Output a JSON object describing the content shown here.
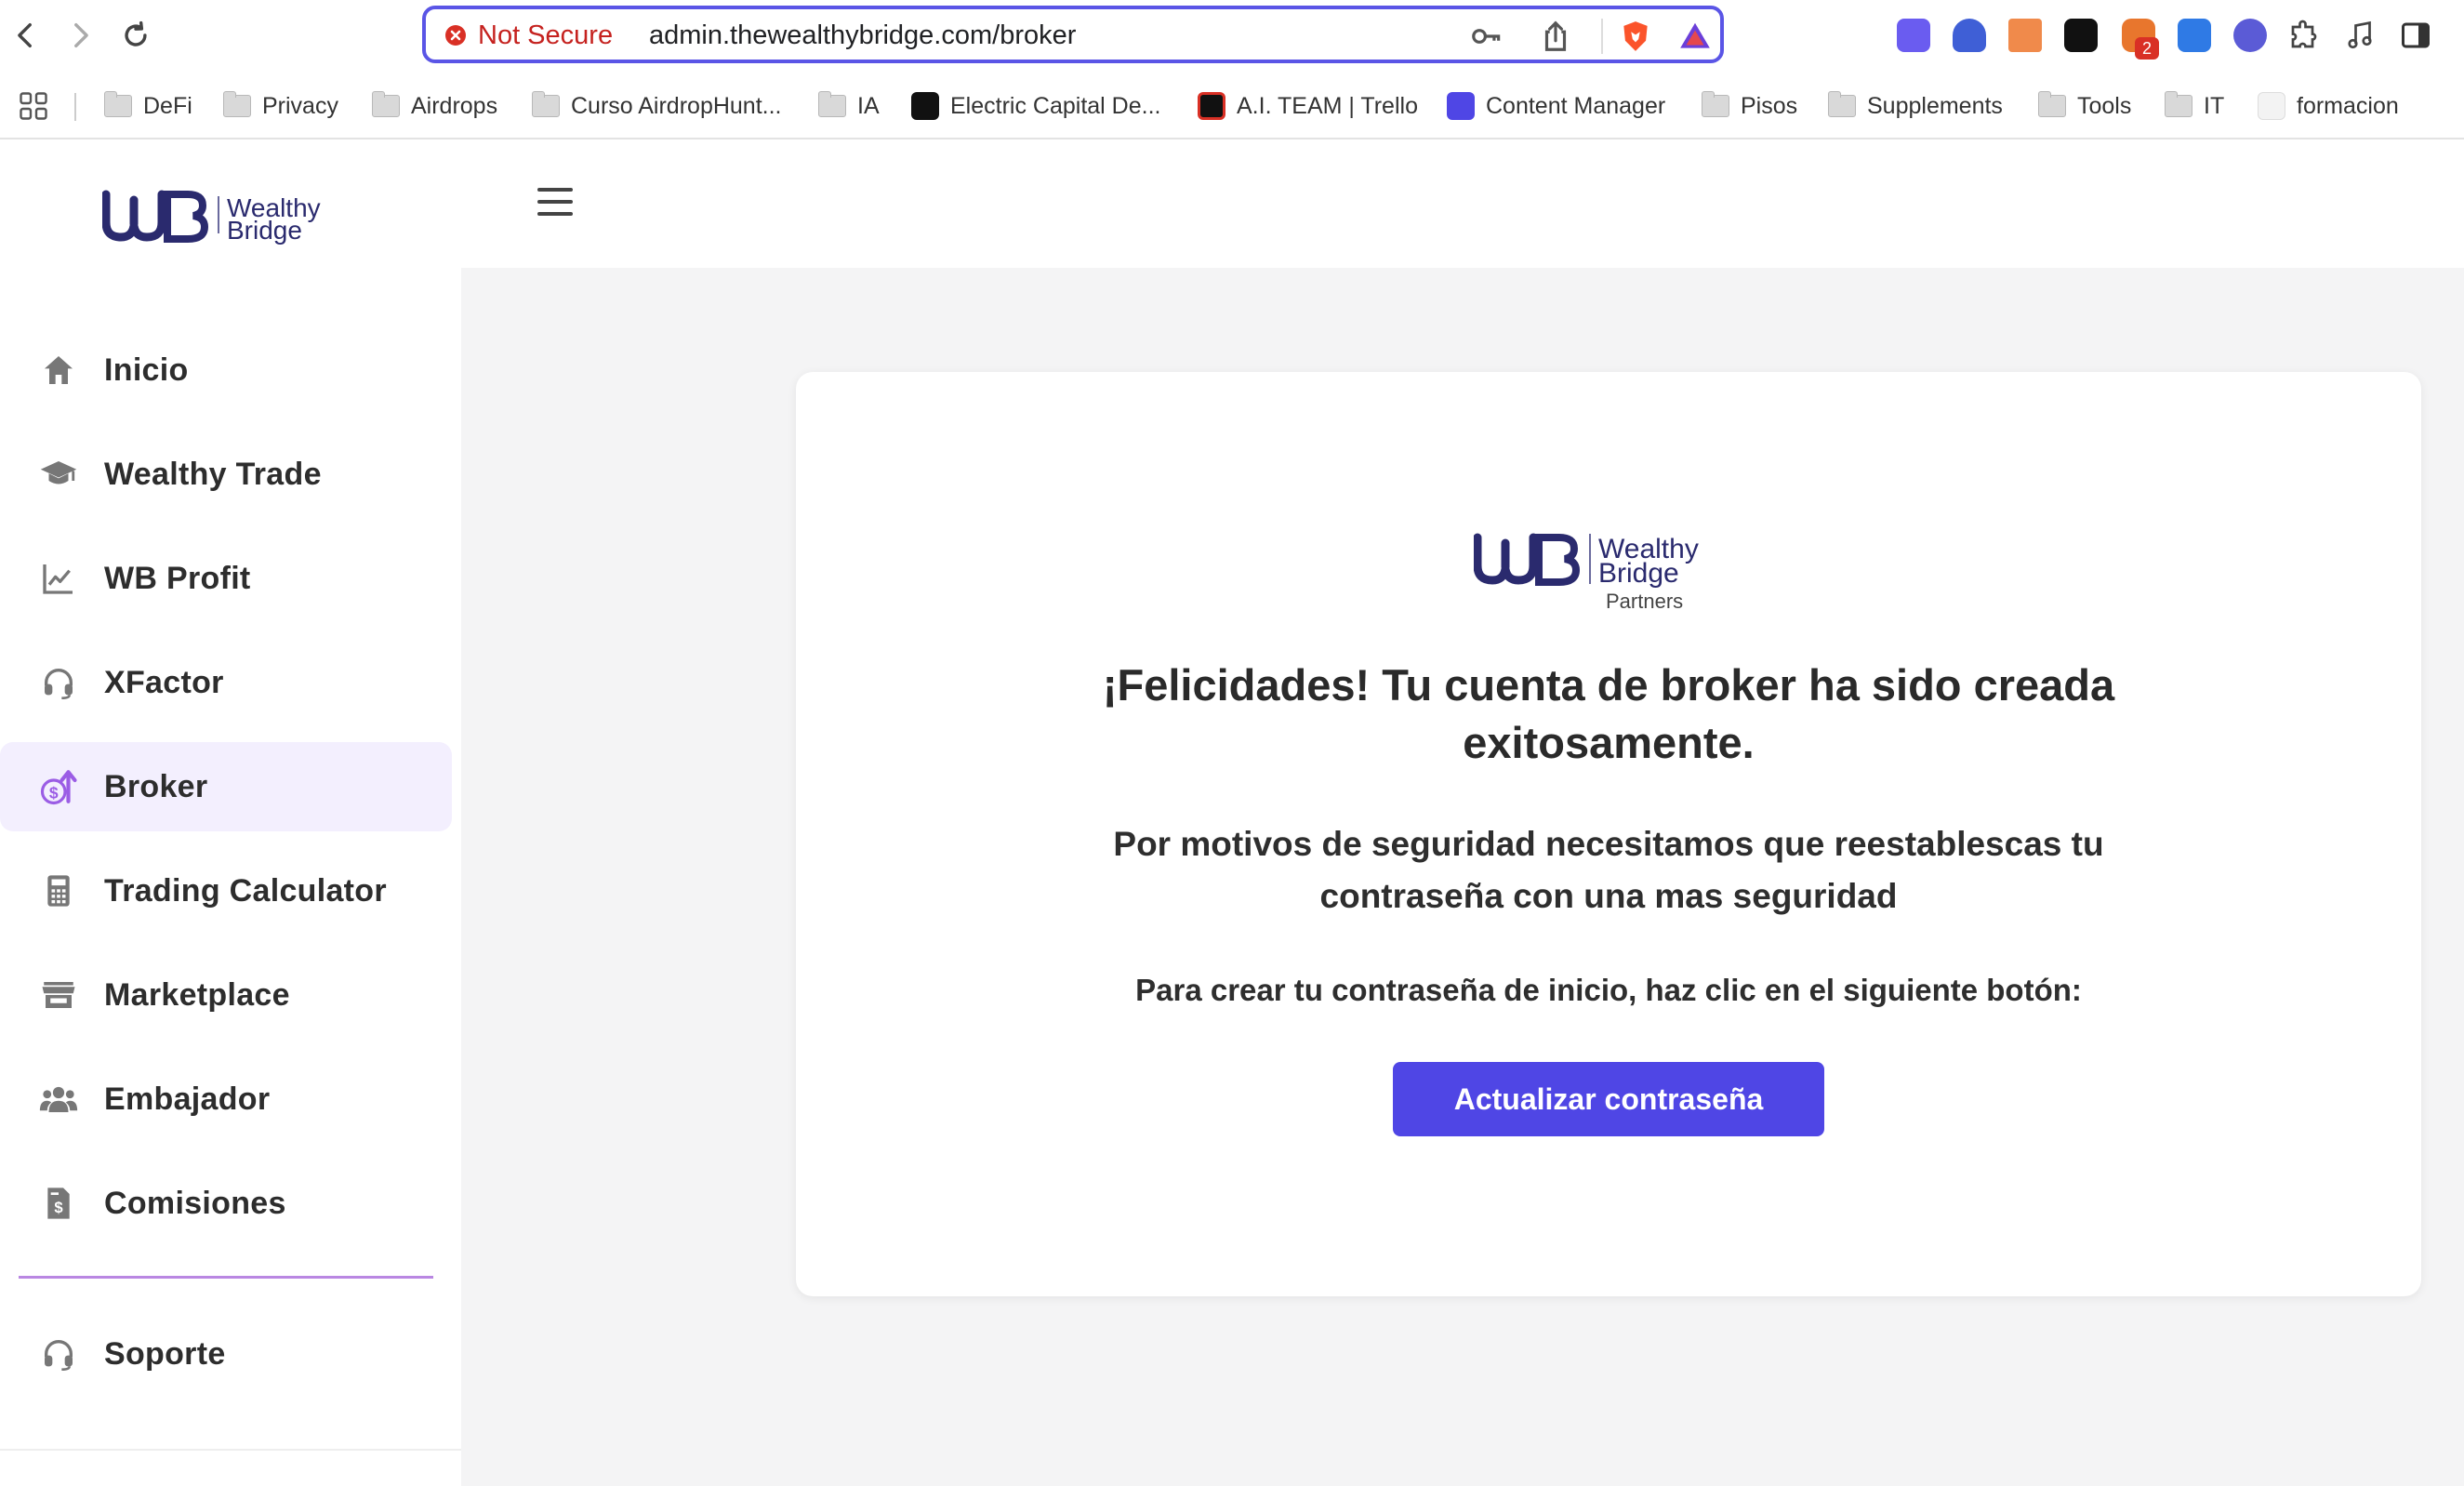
{
  "browser": {
    "security_label": "Not Secure",
    "url": "admin.thewealthybridge.com/broker",
    "extension_badge": "2",
    "bookmarks": [
      {
        "label": "DeFi",
        "type": "folder"
      },
      {
        "label": "Privacy",
        "type": "folder"
      },
      {
        "label": "Airdrops",
        "type": "folder"
      },
      {
        "label": "Curso AirdropHunt...",
        "type": "folder"
      },
      {
        "label": "IA",
        "type": "folder"
      },
      {
        "label": "Electric Capital De...",
        "type": "site"
      },
      {
        "label": "A.I. TEAM | Trello",
        "type": "site"
      },
      {
        "label": "Content Manager",
        "type": "site"
      },
      {
        "label": "Pisos",
        "type": "folder"
      },
      {
        "label": "Supplements",
        "type": "folder"
      },
      {
        "label": "Tools",
        "type": "folder"
      },
      {
        "label": "IT",
        "type": "folder"
      },
      {
        "label": "formacion",
        "type": "site"
      }
    ]
  },
  "brand": {
    "logo_mark": "WB",
    "name_line1": "Wealthy",
    "name_line2": "Bridge",
    "partners_label": "Partners",
    "color_navy": "#2a2a6e",
    "color_accent": "#4f46e5"
  },
  "sidebar": {
    "items": [
      {
        "label": "Inicio",
        "icon": "home-icon"
      },
      {
        "label": "Wealthy Trade",
        "icon": "graduation-cap-icon"
      },
      {
        "label": "WB Profit",
        "icon": "chart-line-icon"
      },
      {
        "label": "XFactor",
        "icon": "headset-icon"
      },
      {
        "label": "Broker",
        "icon": "dollar-up-icon",
        "active": true
      },
      {
        "label": "Trading Calculator",
        "icon": "calculator-icon"
      },
      {
        "label": "Marketplace",
        "icon": "store-icon"
      },
      {
        "label": "Embajador",
        "icon": "users-icon"
      },
      {
        "label": "Comisiones",
        "icon": "invoice-icon"
      }
    ],
    "support": {
      "label": "Soporte",
      "icon": "headset-icon"
    }
  },
  "card": {
    "headline": "¡Felicidades! Tu cuenta de broker ha sido creada exitosamente.",
    "security_text": "Por motivos de seguridad necesitamos que reestablescas tu contraseña con una mas seguridad",
    "instruction": "Para crear tu contraseña de inicio, haz clic en el siguiente botón:",
    "button_label": "Actualizar contraseña"
  }
}
